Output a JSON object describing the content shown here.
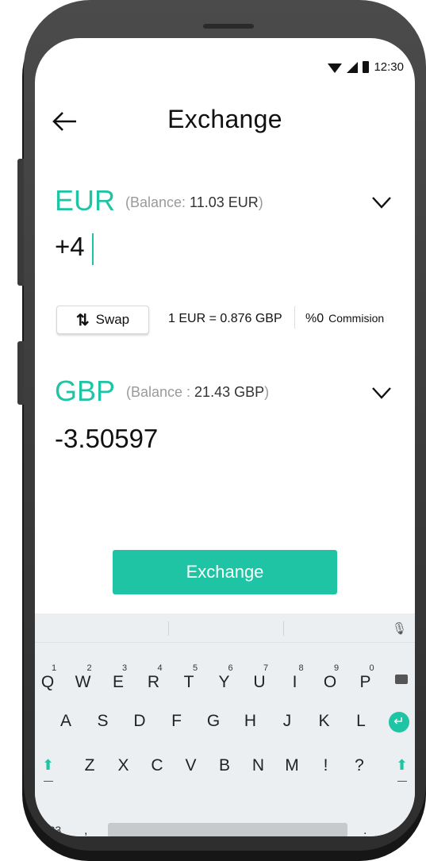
{
  "status_bar": {
    "time": "12:30"
  },
  "header": {
    "title": "Exchange",
    "back_icon": "arrow-left-icon"
  },
  "from": {
    "currency": "EUR",
    "balance_prefix": "(Balance: ",
    "balance_value": "11.03 EUR",
    "balance_suffix": ")",
    "amount": "+4"
  },
  "swap": {
    "label": "Swap",
    "icon": "swap-arrows-icon"
  },
  "rate": "1 EUR = 0.876 GBP",
  "commission": {
    "value": "%0",
    "label": "Commision"
  },
  "to": {
    "currency": "GBP",
    "balance_prefix": "(Balance : ",
    "balance_value": "21.43 GBP",
    "balance_suffix": ")",
    "amount": "-3.50597"
  },
  "action": {
    "label": "Exchange"
  },
  "colors": {
    "accent": "#1fc4a4"
  },
  "keyboard": {
    "row1": [
      "Q",
      "W",
      "E",
      "R",
      "T",
      "Y",
      "U",
      "I",
      "O",
      "P"
    ],
    "row1_numbers": [
      "1",
      "2",
      "3",
      "4",
      "5",
      "6",
      "7",
      "8",
      "9",
      "0"
    ],
    "row2": [
      "A",
      "S",
      "D",
      "F",
      "G",
      "H",
      "J",
      "K",
      "L"
    ],
    "row3": [
      "Z",
      "X",
      "C",
      "V",
      "B",
      "N",
      "M",
      "!",
      "?"
    ],
    "symbols_key": "?123",
    "comma_key": ",",
    "period_key": ".",
    "emoji_key": "☺"
  }
}
